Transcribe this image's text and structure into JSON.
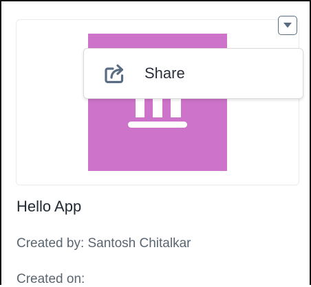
{
  "menu": {
    "items": [
      {
        "label": "Share",
        "icon": "share-icon"
      }
    ]
  },
  "dropdown": {
    "icon": "chevron-down-icon"
  },
  "app": {
    "title": "Hello App",
    "created_by": "Created by: Santosh Chitalkar",
    "created_on": "Created on:",
    "thumbnail_icon": "app-columns-icon"
  },
  "colors": {
    "thumbnail": "#cd73c9",
    "text_primary": "#222a33",
    "text_secondary": "#5b6570",
    "icon": "#5a6c82"
  }
}
